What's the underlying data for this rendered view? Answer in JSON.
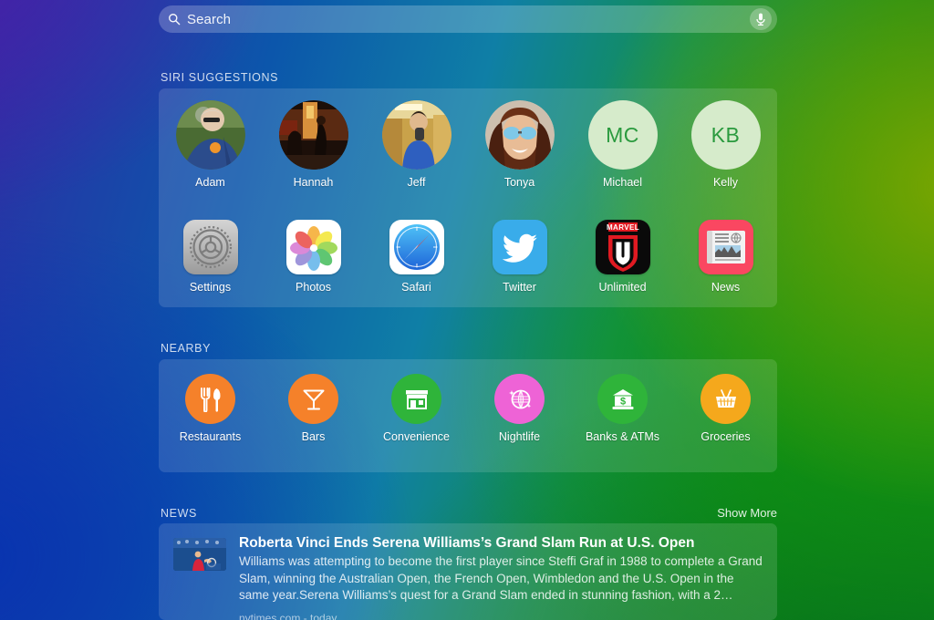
{
  "search": {
    "placeholder": "Search",
    "icon": "search-icon",
    "mic_icon": "microphone-icon"
  },
  "sections": {
    "siri": {
      "title": "SIRI SUGGESTIONS"
    },
    "nearby": {
      "title": "NEARBY"
    },
    "news": {
      "title": "NEWS",
      "show_more": "Show More"
    }
  },
  "contacts": [
    {
      "name": "Adam",
      "type": "photo",
      "photo": "runner-blue-singlet"
    },
    {
      "name": "Hannah",
      "type": "photo",
      "photo": "night-street-scene"
    },
    {
      "name": "Jeff",
      "type": "photo",
      "photo": "indoor-gym-man"
    },
    {
      "name": "Tonya",
      "type": "photo",
      "photo": "woman-sunglasses-curly-hair"
    },
    {
      "name": "Michael",
      "type": "initials",
      "initials": "MC"
    },
    {
      "name": "Kelly",
      "type": "initials",
      "initials": "KB"
    }
  ],
  "apps": [
    {
      "name": "Settings",
      "icon": "settings-gear-icon"
    },
    {
      "name": "Photos",
      "icon": "photos-flower-icon"
    },
    {
      "name": "Safari",
      "icon": "safari-compass-icon"
    },
    {
      "name": "Twitter",
      "icon": "twitter-bird-icon"
    },
    {
      "name": "Unlimited",
      "icon": "marvel-unlimited-icon"
    },
    {
      "name": "News",
      "icon": "news-paper-icon"
    }
  ],
  "nearby": [
    {
      "name": "Restaurants",
      "icon": "fork-knife-icon",
      "color": "#F5812A"
    },
    {
      "name": "Bars",
      "icon": "cocktail-icon",
      "color": "#F5812A"
    },
    {
      "name": "Convenience",
      "icon": "storefront-icon",
      "color": "#2FB43A"
    },
    {
      "name": "Nightlife",
      "icon": "disco-ball-icon",
      "color": "#EE63D6"
    },
    {
      "name": "Banks & ATMs",
      "icon": "bank-dollar-icon",
      "color": "#2FB43A"
    },
    {
      "name": "Groceries",
      "icon": "basket-icon",
      "color": "#F5A81C"
    }
  ],
  "news_items": [
    {
      "title": "Roberta Vinci Ends Serena Williams’s Grand Slam Run at U.S. Open",
      "description": "Williams was attempting to become the first player since Steffi Graf in 1988 to complete a Grand Slam, winning the Australian Open, the French Open, Wimbledon and the U.S. Open in the same year.Serena Williams’s quest for a Grand Slam ended in stunning fashion, with a 2…",
      "source": "nytimes.com - today",
      "thumb": "tennis-player-red-dress"
    }
  ],
  "colors": {
    "card_overlay": "#FFFFFF",
    "initials_bg": "#D6EBCB",
    "initials_fg": "#2A9A3E"
  }
}
